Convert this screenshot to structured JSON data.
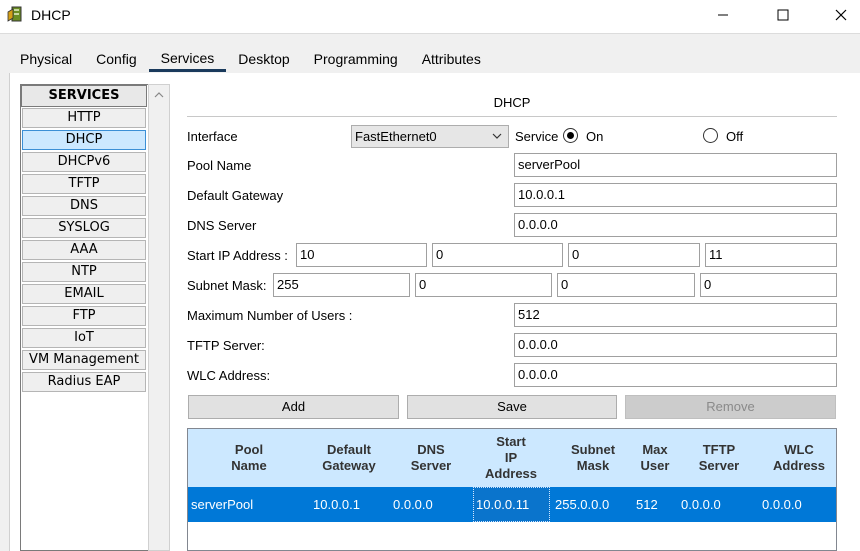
{
  "window": {
    "title": "DHCP",
    "icon": "packet-tracer-server-icon",
    "controls": [
      "minimize-icon",
      "maximize-icon",
      "close-icon"
    ]
  },
  "tabs": [
    {
      "label": "Physical",
      "active": false
    },
    {
      "label": "Config",
      "active": false
    },
    {
      "label": "Services",
      "active": true
    },
    {
      "label": "Desktop",
      "active": false
    },
    {
      "label": "Programming",
      "active": false
    },
    {
      "label": "Attributes",
      "active": false
    }
  ],
  "services": {
    "header": "SERVICES",
    "items": [
      "HTTP",
      "DHCP",
      "DHCPv6",
      "TFTP",
      "DNS",
      "SYSLOG",
      "AAA",
      "NTP",
      "EMAIL",
      "FTP",
      "IoT",
      "VM Management",
      "Radius EAP"
    ],
    "selected": "DHCP"
  },
  "dhcp": {
    "title": "DHCP",
    "interface_label": "Interface",
    "interface_value": "FastEthernet0",
    "service_label": "Service",
    "on_label": "On",
    "off_label": "Off",
    "service_on": true,
    "pool_name_label": "Pool Name",
    "pool_name_value": "serverPool",
    "default_gateway_label": "Default Gateway",
    "default_gateway_value": "10.0.0.1",
    "dns_server_label": "DNS Server",
    "dns_server_value": "0.0.0.0",
    "start_ip_label": "Start IP Address :",
    "start_ip": [
      "10",
      "0",
      "0",
      "11"
    ],
    "subnet_mask_label": "Subnet Mask:",
    "subnet_mask": [
      "255",
      "0",
      "0",
      "0"
    ],
    "max_users_label": "Maximum Number of Users :",
    "max_users_value": "512",
    "tftp_label": "TFTP Server:",
    "tftp_value": "0.0.0.0",
    "wlc_label": "WLC Address:",
    "wlc_value": "0.0.0.0",
    "add_label": "Add",
    "save_label": "Save",
    "remove_label": "Remove"
  },
  "table": {
    "columns": [
      [
        "Pool",
        "Name"
      ],
      [
        "Default",
        "Gateway"
      ],
      [
        "DNS",
        "Server"
      ],
      [
        "Start",
        "IP",
        "Address"
      ],
      [
        "Subnet",
        "Mask"
      ],
      [
        "Max",
        "User"
      ],
      [
        "TFTP",
        "Server"
      ],
      [
        "WLC",
        "Address"
      ]
    ],
    "rows": [
      [
        "serverPool",
        "10.0.0.1",
        "0.0.0.0",
        "10.0.0.11",
        "255.0.0.0",
        "512",
        "0.0.0.0",
        "0.0.0.0"
      ]
    ]
  },
  "colors": {
    "selection": "#0078d7",
    "header_bg": "#cce8ff",
    "tab_underline": "#1a3a5c"
  }
}
